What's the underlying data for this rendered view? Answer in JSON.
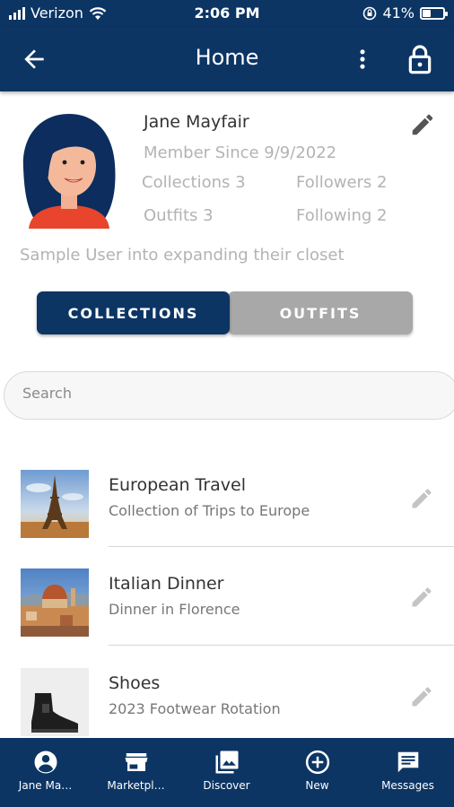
{
  "status_bar": {
    "carrier": "Verizon",
    "time": "2:06 PM",
    "battery": "41%",
    "battery_level": 0.41
  },
  "header": {
    "title": "Home"
  },
  "profile": {
    "name": "Jane Mayfair",
    "member_since": "Member Since 9/9/2022",
    "collections": "Collections 3",
    "followers": "Followers 2",
    "outfits": "Outfits 3",
    "following": "Following 2",
    "bio": "Sample User into expanding their closet"
  },
  "tabs": {
    "collections": "COLLECTIONS",
    "outfits": "OUTFITS",
    "active": "COLLECTIONS"
  },
  "search": {
    "placeholder": "Search",
    "value": ""
  },
  "collections": [
    {
      "title": "European Travel",
      "subtitle": "Collection of Trips to Europe",
      "thumbnail": "eiffel-tower-photo"
    },
    {
      "title": "Italian Dinner",
      "subtitle": "Dinner in Florence",
      "thumbnail": "florence-skyline-photo"
    },
    {
      "title": "Shoes",
      "subtitle": "2023 Footwear Rotation",
      "thumbnail": "black-boot-photo"
    }
  ],
  "bottom_nav": [
    {
      "label": "Jane Ma…",
      "icon": "account-circle-icon"
    },
    {
      "label": "Marketpl…",
      "icon": "storefront-icon"
    },
    {
      "label": "Discover",
      "icon": "photo-library-icon"
    },
    {
      "label": "New",
      "icon": "add-circle-icon"
    },
    {
      "label": "Messages",
      "icon": "chat-icon"
    }
  ],
  "colors": {
    "primary": "#0c3564",
    "inactive_tab": "#a8a8a8",
    "muted_text": "#b3b3b3",
    "avatar_shirt": "#e8452c"
  }
}
